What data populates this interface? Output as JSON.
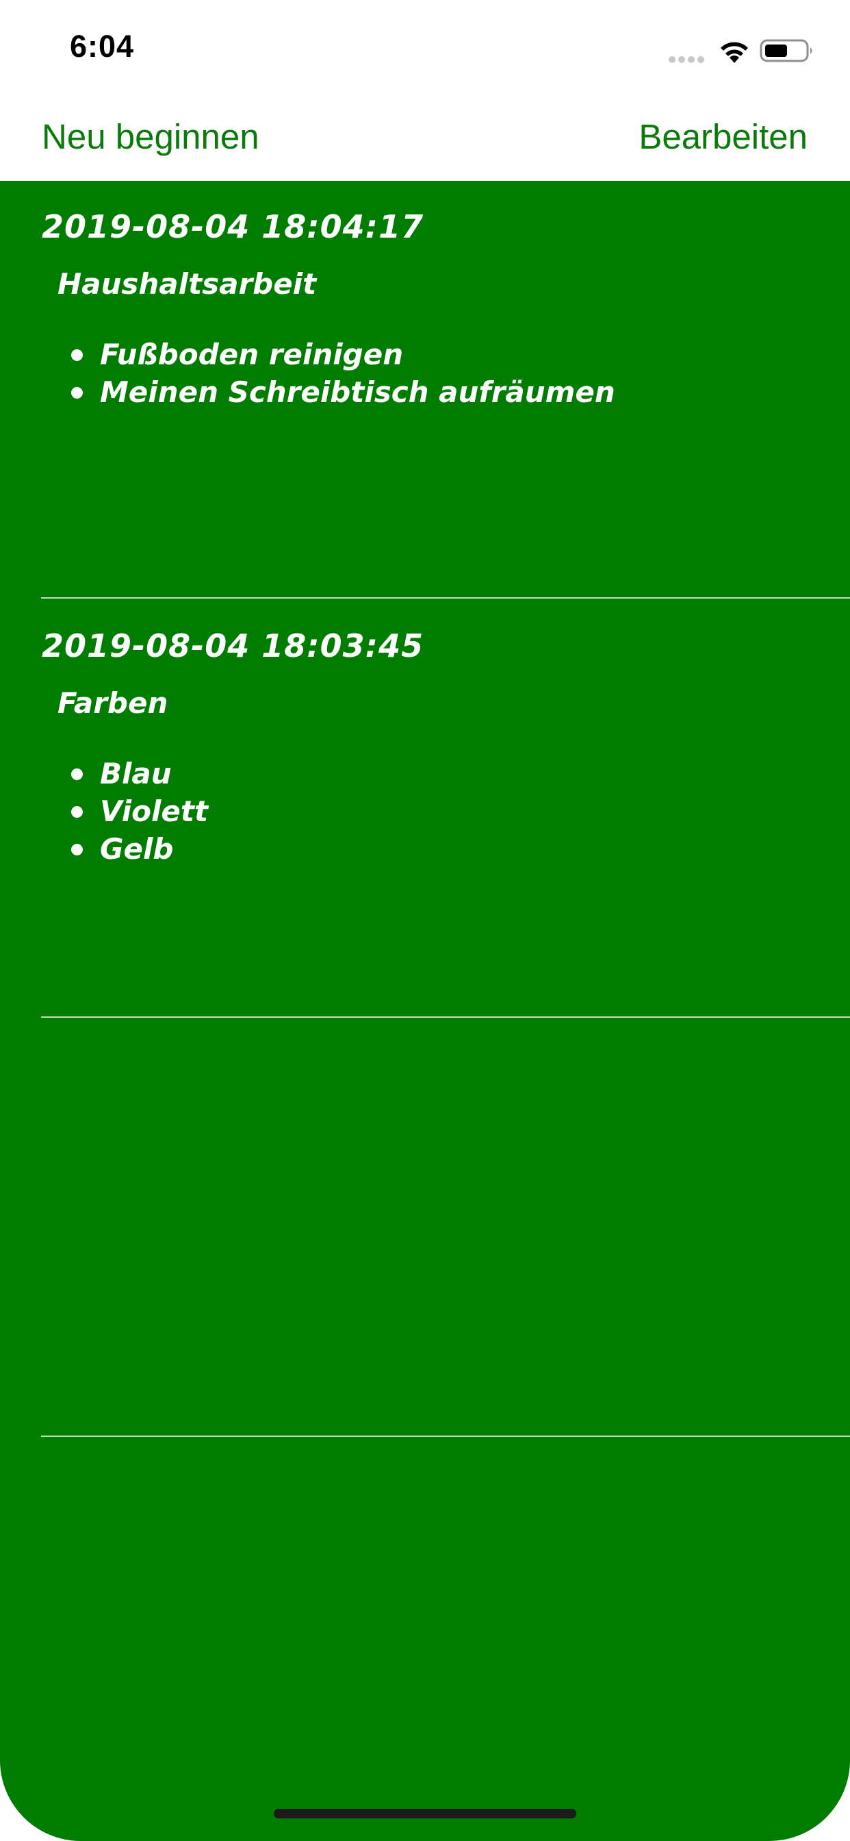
{
  "status_bar": {
    "time": "6:04"
  },
  "nav": {
    "left_label": "Neu beginnen",
    "right_label": "Bearbeiten"
  },
  "colors": {
    "accent": "#0a7a0a",
    "background": "#007c00",
    "text": "#ffffff"
  },
  "notes": [
    {
      "timestamp": "2019-08-04 18:04:17",
      "title": "Haushaltsarbeit",
      "items": [
        "Fußboden reinigen",
        "Meinen Schreibtisch aufräumen"
      ]
    },
    {
      "timestamp": "2019-08-04 18:03:45",
      "title": "Farben",
      "items": [
        "Blau",
        "Violett",
        "Gelb"
      ]
    }
  ]
}
